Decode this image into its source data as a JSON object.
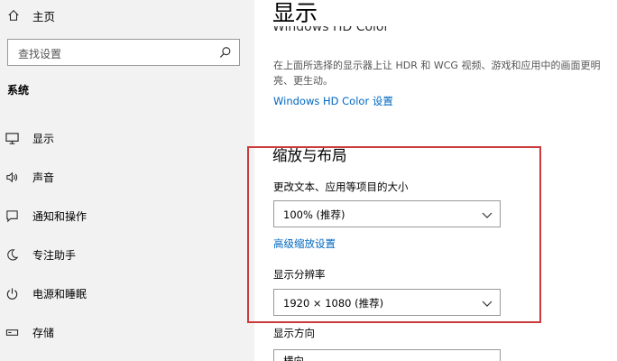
{
  "sidebar": {
    "home_label": "主页",
    "search_placeholder": "查找设置",
    "section_title": "系统",
    "items": [
      {
        "label": "显示",
        "icon": "monitor-icon"
      },
      {
        "label": "声音",
        "icon": "speaker-icon"
      },
      {
        "label": "通知和操作",
        "icon": "notification-icon"
      },
      {
        "label": "专注助手",
        "icon": "moon-icon"
      },
      {
        "label": "电源和睡眠",
        "icon": "power-icon"
      },
      {
        "label": "存储",
        "icon": "storage-icon"
      }
    ]
  },
  "main": {
    "title": "显示",
    "hdr_heading_partial": "Windows HD Color",
    "hdr_description": "在上面所选择的显示器上让 HDR 和 WCG 视频、游戏和应用中的画面更明亮、更生动。",
    "hdr_link": "Windows HD Color 设置",
    "scale_section_title": "缩放与布局",
    "text_size_label": "更改文本、应用等项目的大小",
    "text_size_value": "100% (推荐)",
    "advanced_scaling_link": "高级缩放设置",
    "resolution_label": "显示分辨率",
    "resolution_value": "1920 × 1080 (推荐)",
    "orientation_label": "显示方向",
    "orientation_value": "横向"
  },
  "colors": {
    "accent": "#0067c0",
    "highlight_border": "#cc3b3b",
    "sidebar_bg": "#f2f2f2"
  }
}
